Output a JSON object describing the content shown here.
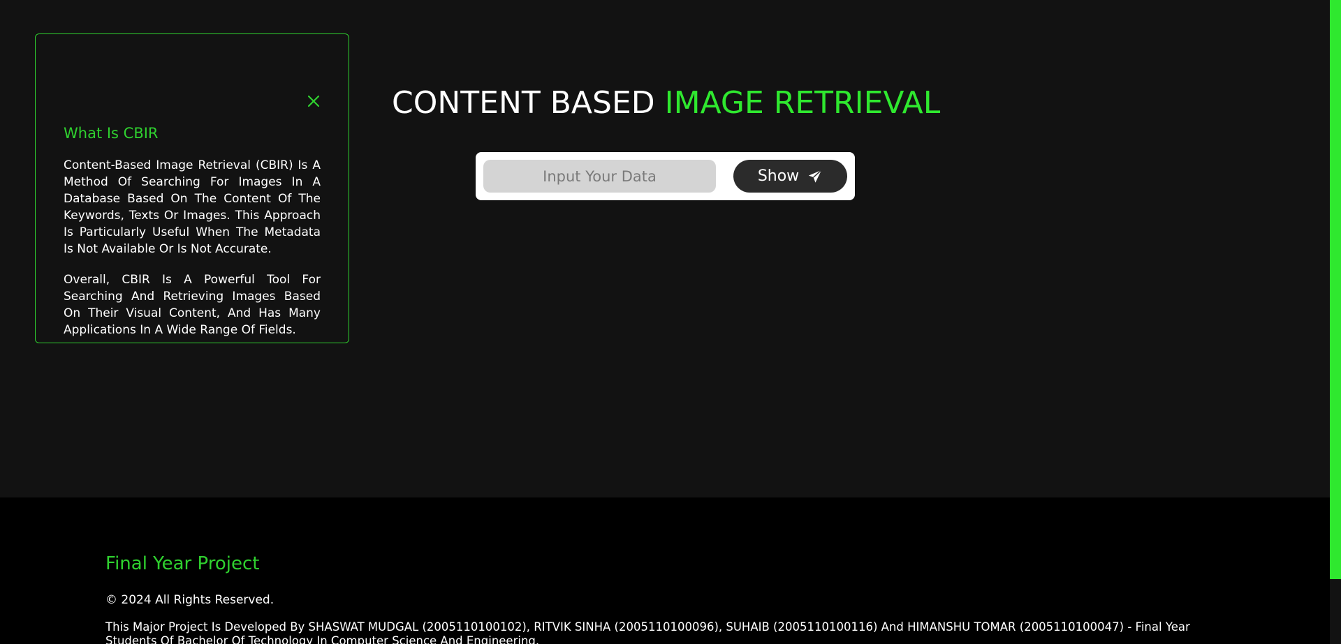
{
  "info_card": {
    "title": "What Is CBIR",
    "paragraphs": [
      "Content-Based Image Retrieval (CBIR) Is A Method Of Searching For Images In A Database Based On The Content Of The Keywords, Texts Or Images. This Approach Is Particularly Useful When The Metadata Is Not Available Or Is Not Accurate.",
      "Overall, CBIR Is A Powerful Tool For Searching And Retrieving Images Based On Their Visual Content, And Has Many Applications In A Wide Range Of Fields."
    ],
    "close_icon": "close-icon"
  },
  "hero": {
    "title_plain": "CONTENT BASED",
    "title_accent": "IMAGE RETRIEVAL"
  },
  "search": {
    "placeholder": "Input Your Data",
    "value": "",
    "button_label": "Show",
    "button_icon": "paper-plane-icon"
  },
  "footer": {
    "title": "Final Year Project",
    "copyright": "© 2024 All Rights Reserved.",
    "credits": "This Major Project Is Developed By SHASWAT MUDGAL (2005110100102), RITVIK SINHA (2005110100096), SUHAIB (2005110100116) And HIMANSHU TOMAR (2005110100047) - Final Year Students Of Bachelor Of Technology In Computer Science And Engineering."
  },
  "colors": {
    "accent": "#2fe82f",
    "card_border": "#2fd12f",
    "background": "#121212",
    "footer_background": "#000000"
  }
}
